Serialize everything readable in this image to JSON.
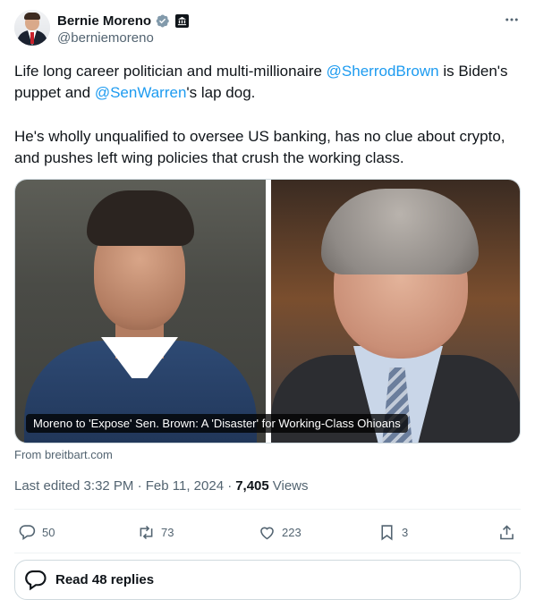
{
  "author": {
    "name": "Bernie Moreno",
    "handle": "@berniemoreno"
  },
  "tweet": {
    "p1_before": "Life long career politician and multi-millionaire ",
    "p1_mention1": "@SherrodBrown",
    "p1_middle": " is Biden's puppet and ",
    "p1_mention2": "@SenWarren",
    "p1_after": "'s lap dog.",
    "p2": "He's wholly unqualified to oversee US banking, has no clue about crypto, and pushes left wing policies that crush the working class."
  },
  "card": {
    "caption": "Moreno to 'Expose' Sen. Brown: A 'Disaster' for Working-Class Ohioans",
    "source": "From breitbart.com"
  },
  "meta": {
    "edited": "Last edited 3:32 PM · Feb 11, 2024 · ",
    "views_count": "7,405",
    "views_label": " Views"
  },
  "actions": {
    "replies": "50",
    "reposts": "73",
    "likes": "223",
    "bookmarks": "3"
  },
  "read_replies": "Read 48 replies",
  "colors": {
    "accent": "#1d9bf0",
    "secondary_text": "#536471",
    "primary_text": "#0f1419"
  }
}
